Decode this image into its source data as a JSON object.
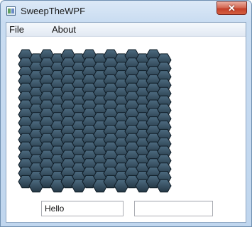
{
  "window": {
    "title": "SweepTheWPF",
    "app_icon": "window-app-icon",
    "close_glyph": "✕"
  },
  "menu": {
    "items": [
      {
        "label": "File"
      },
      {
        "label": "About"
      }
    ]
  },
  "board": {
    "rows": 16,
    "cols": 8,
    "cell_color_top": "#4d6b80",
    "cell_color_bottom": "#253846",
    "outline_color": "#0f1c26"
  },
  "footer": {
    "text_input_1": "Hello",
    "text_input_2": ""
  }
}
